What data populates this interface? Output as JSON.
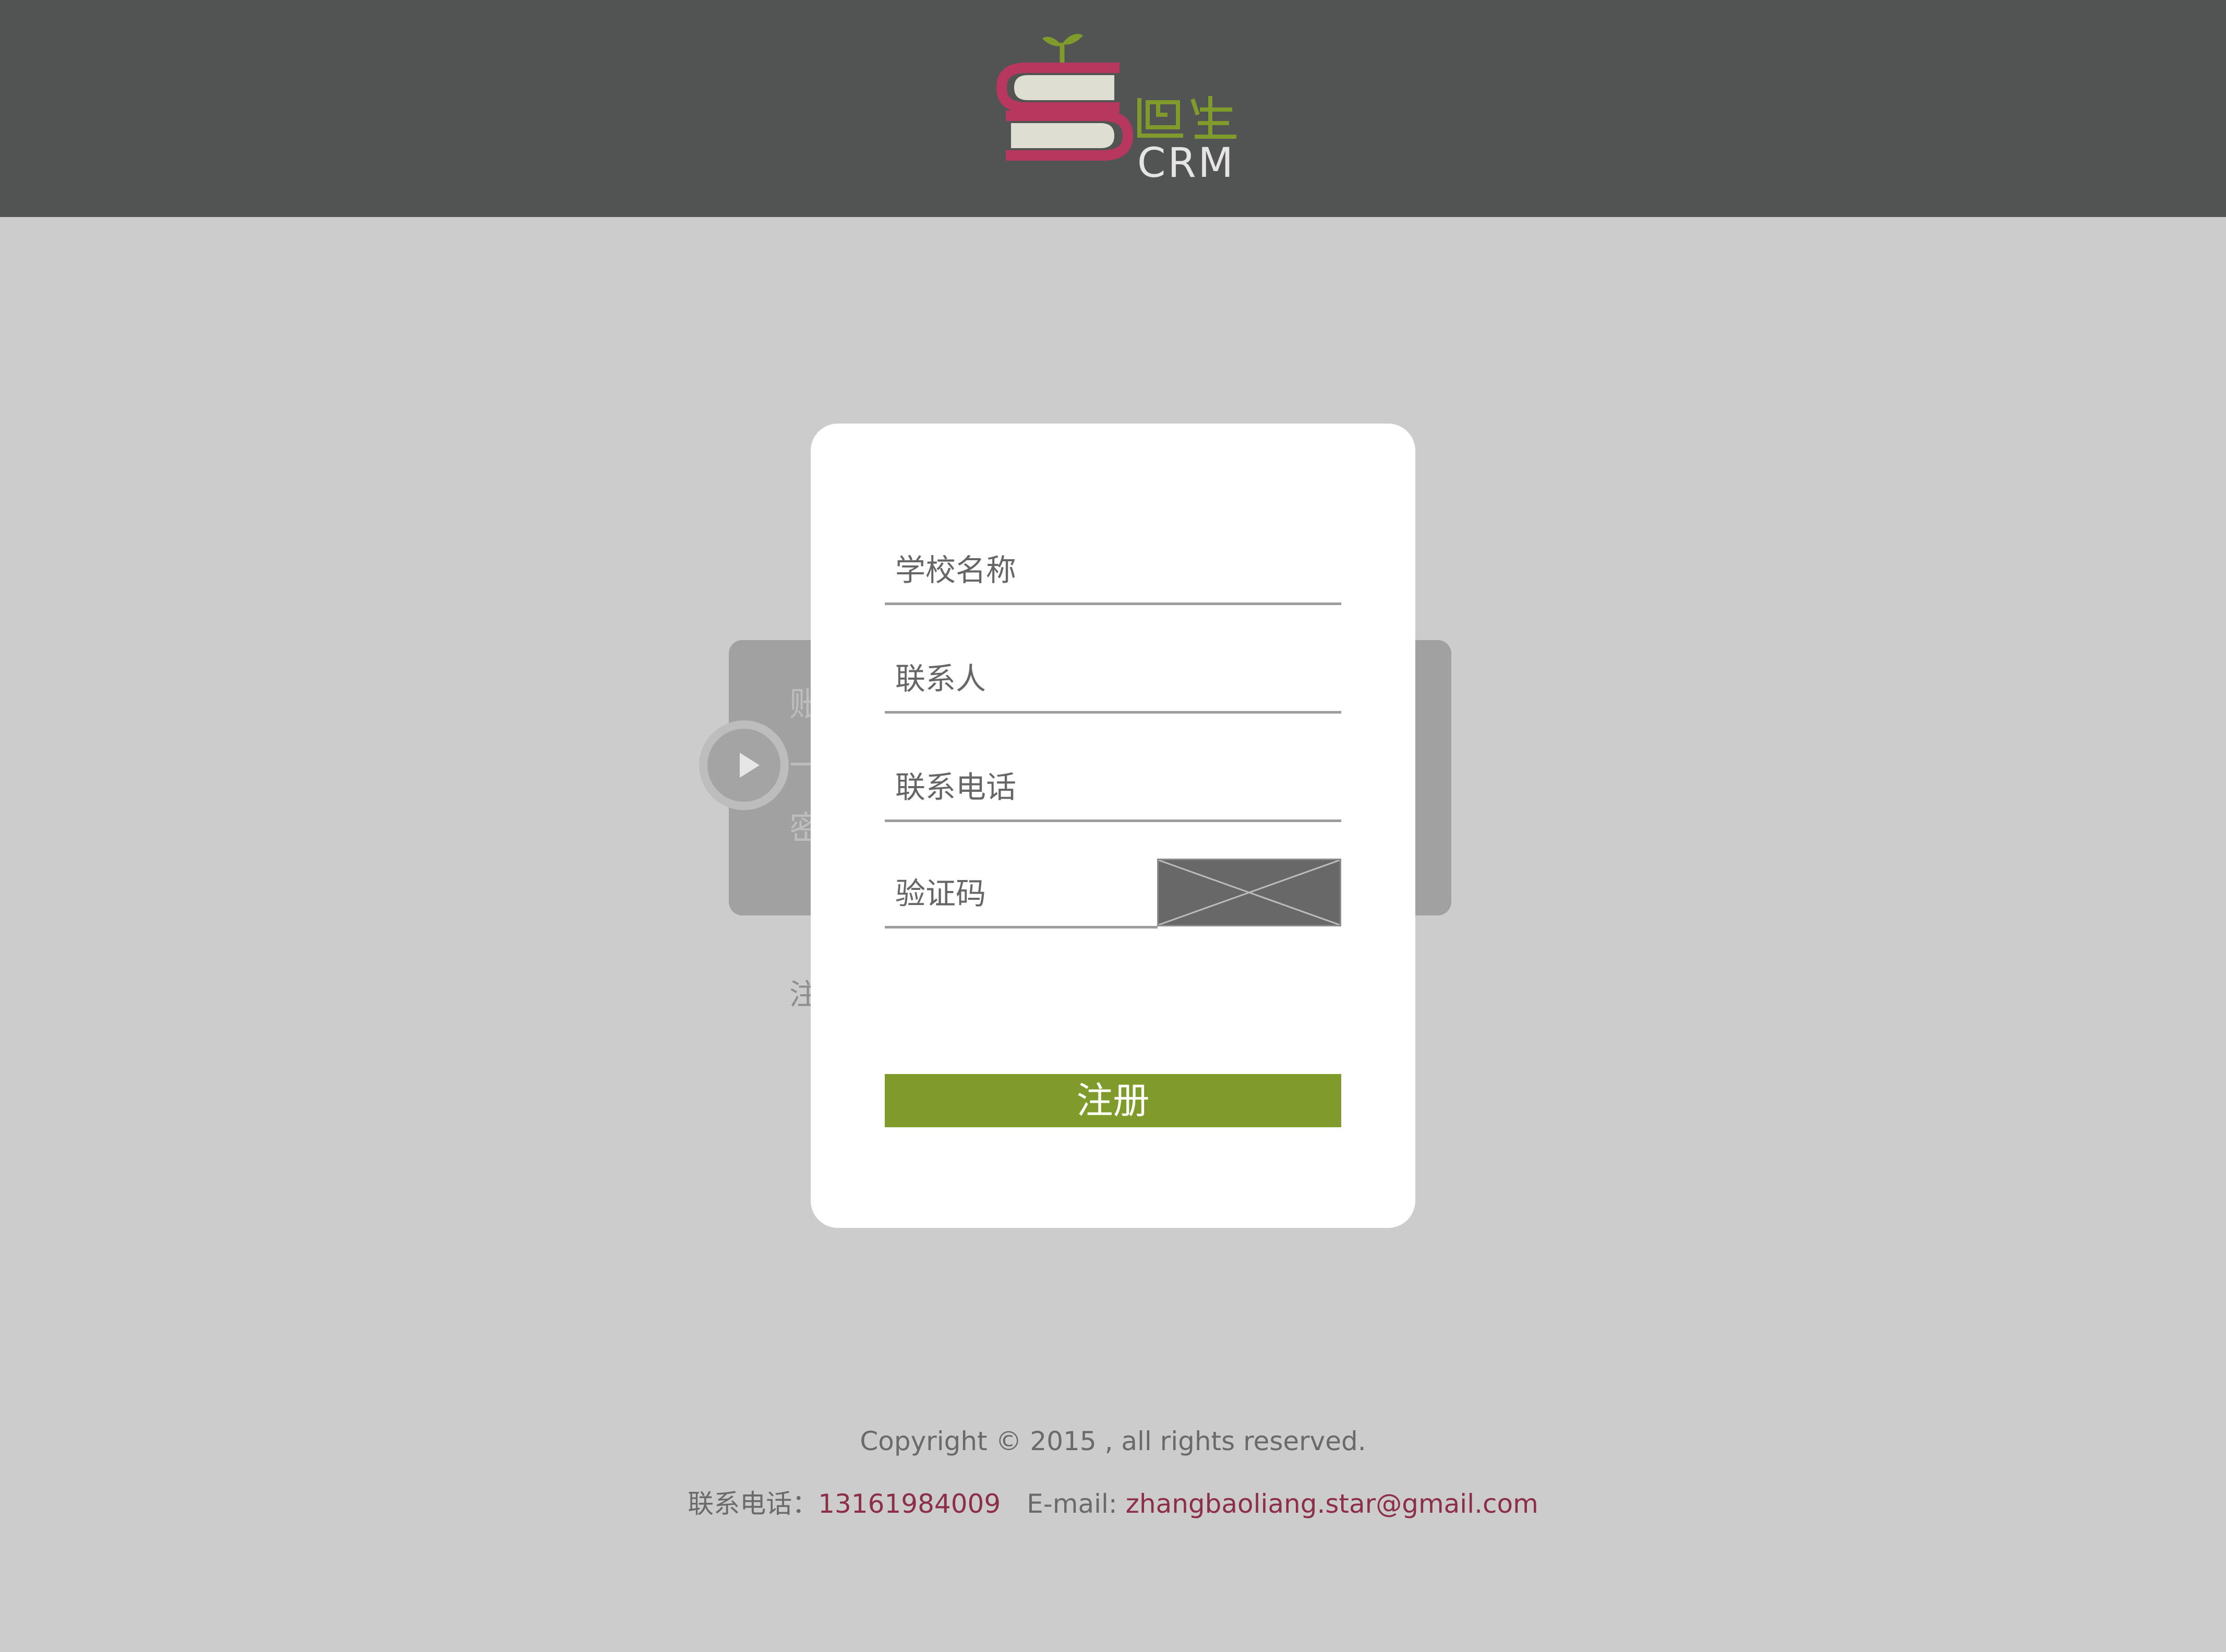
{
  "header": {
    "logo_text": "CRM",
    "logo_glyphs": "迈生",
    "logo_icon": "stacked-books-sprout-icon"
  },
  "background_login": {
    "visible_chars": [
      "账",
      "一",
      "密"
    ],
    "register_char": "注",
    "play_icon": "play-icon"
  },
  "form": {
    "school_placeholder": "学校名称",
    "contact_placeholder": "联系人",
    "phone_placeholder": "联系电话",
    "captcha_placeholder": "验证码",
    "captcha_image_icon": "broken-image-icon",
    "submit_label": "注册"
  },
  "footer": {
    "copyright": "Copyright © 2015 , all rights reserved.",
    "phone_label": "联系电话：",
    "phone": "13161984009",
    "email_label": "E-mail: ",
    "email": "zhangbaoliang.star@gmail.com"
  },
  "colors": {
    "header_bg": "#525453",
    "page_bg": "#cccccc",
    "brand_pink": "#b8375f",
    "brand_green": "#7f9b2b",
    "accent_text": "#8d2e48"
  }
}
